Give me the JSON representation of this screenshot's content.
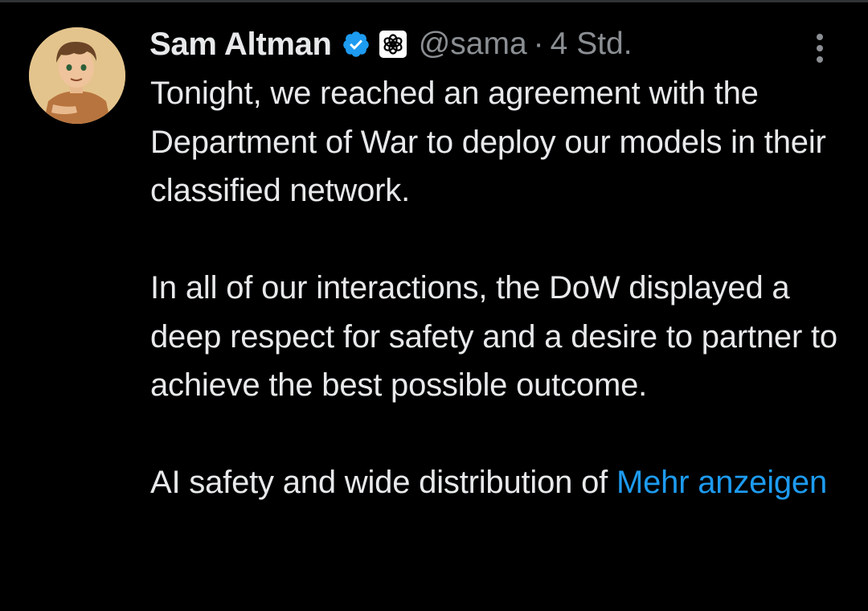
{
  "tweet": {
    "author_name": "Sam Altman",
    "handle": "@sama",
    "separator": "·",
    "timestamp": "4 Std.",
    "paragraphs": [
      "Tonight, we reached an agreement with the Department of War to deploy our models in their classified network.",
      "In all of our interactions, the DoW displayed a deep respect for safety and a desire to partner to achieve the best possible outcome."
    ],
    "truncated_text": "AI safety and wide distribution of",
    "show_more_label": "Mehr anzeigen"
  },
  "icons": {
    "verified": "verified-badge-icon",
    "affiliate": "openai-logo-icon",
    "more": "more-vertical-icon"
  },
  "colors": {
    "background": "#000000",
    "primary_text": "#e7e9ea",
    "secondary_text": "#8b8f93",
    "link": "#1d9bf0",
    "verified": "#1d9bf0"
  }
}
